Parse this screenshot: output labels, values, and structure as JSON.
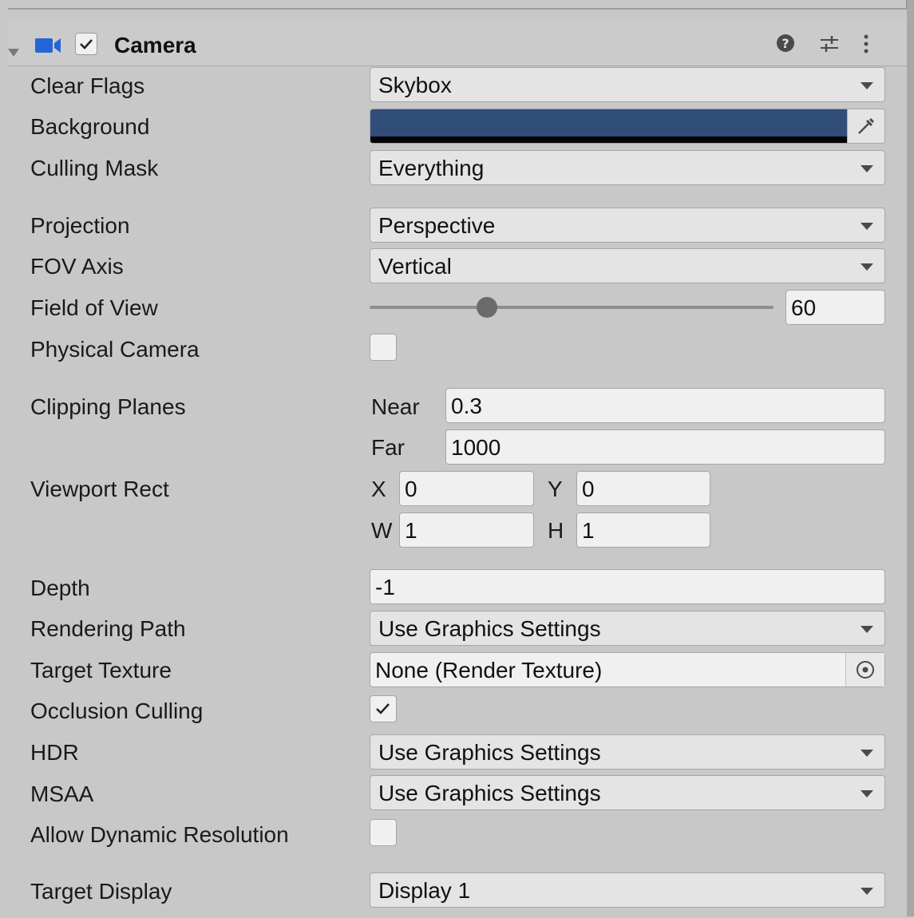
{
  "component": {
    "title": "Camera",
    "enabled": true,
    "header_icons": [
      "help-icon",
      "presets-icon",
      "kebab-menu-icon"
    ]
  },
  "fields": {
    "clear_flags": {
      "label": "Clear Flags",
      "value": "Skybox"
    },
    "background": {
      "label": "Background",
      "color": "#314d79"
    },
    "culling_mask": {
      "label": "Culling Mask",
      "value": "Everything"
    },
    "projection": {
      "label": "Projection",
      "value": "Perspective"
    },
    "fov_axis": {
      "label": "FOV Axis",
      "value": "Vertical"
    },
    "field_of_view": {
      "label": "Field of View",
      "value": "60",
      "slider_fraction": 0.29
    },
    "physical_camera": {
      "label": "Physical Camera",
      "checked": false
    },
    "clipping_planes": {
      "label": "Clipping Planes",
      "near_label": "Near",
      "near": "0.3",
      "far_label": "Far",
      "far": "1000"
    },
    "viewport_rect": {
      "label": "Viewport Rect",
      "x_label": "X",
      "x": "0",
      "y_label": "Y",
      "y": "0",
      "w_label": "W",
      "w": "1",
      "h_label": "H",
      "h": "1"
    },
    "depth": {
      "label": "Depth",
      "value": "-1"
    },
    "rendering_path": {
      "label": "Rendering Path",
      "value": "Use Graphics Settings"
    },
    "target_texture": {
      "label": "Target Texture",
      "value": "None (Render Texture)"
    },
    "occlusion_culling": {
      "label": "Occlusion Culling",
      "checked": true
    },
    "hdr": {
      "label": "HDR",
      "value": "Use Graphics Settings"
    },
    "msaa": {
      "label": "MSAA",
      "value": "Use Graphics Settings"
    },
    "allow_dynamic_resolution": {
      "label": "Allow Dynamic Resolution",
      "checked": false
    },
    "target_display": {
      "label": "Target Display",
      "value": "Display 1"
    }
  },
  "colors": {
    "accent_camera_icon": "#2466d6",
    "panel_bg": "#c8c8c8",
    "field_bg": "#e4e4e4"
  }
}
